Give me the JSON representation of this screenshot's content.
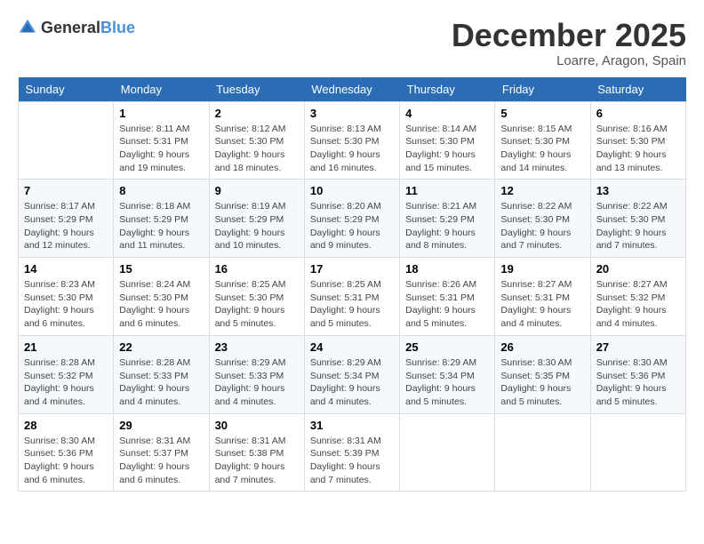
{
  "header": {
    "logo_general": "General",
    "logo_blue": "Blue",
    "month_title": "December 2025",
    "location": "Loarre, Aragon, Spain"
  },
  "days_of_week": [
    "Sunday",
    "Monday",
    "Tuesday",
    "Wednesday",
    "Thursday",
    "Friday",
    "Saturday"
  ],
  "weeks": [
    [
      {
        "day": "",
        "sunrise": "",
        "sunset": "",
        "daylight": ""
      },
      {
        "day": "1",
        "sunrise": "Sunrise: 8:11 AM",
        "sunset": "Sunset: 5:31 PM",
        "daylight": "Daylight: 9 hours and 19 minutes."
      },
      {
        "day": "2",
        "sunrise": "Sunrise: 8:12 AM",
        "sunset": "Sunset: 5:30 PM",
        "daylight": "Daylight: 9 hours and 18 minutes."
      },
      {
        "day": "3",
        "sunrise": "Sunrise: 8:13 AM",
        "sunset": "Sunset: 5:30 PM",
        "daylight": "Daylight: 9 hours and 16 minutes."
      },
      {
        "day": "4",
        "sunrise": "Sunrise: 8:14 AM",
        "sunset": "Sunset: 5:30 PM",
        "daylight": "Daylight: 9 hours and 15 minutes."
      },
      {
        "day": "5",
        "sunrise": "Sunrise: 8:15 AM",
        "sunset": "Sunset: 5:30 PM",
        "daylight": "Daylight: 9 hours and 14 minutes."
      },
      {
        "day": "6",
        "sunrise": "Sunrise: 8:16 AM",
        "sunset": "Sunset: 5:30 PM",
        "daylight": "Daylight: 9 hours and 13 minutes."
      }
    ],
    [
      {
        "day": "7",
        "sunrise": "Sunrise: 8:17 AM",
        "sunset": "Sunset: 5:29 PM",
        "daylight": "Daylight: 9 hours and 12 minutes."
      },
      {
        "day": "8",
        "sunrise": "Sunrise: 8:18 AM",
        "sunset": "Sunset: 5:29 PM",
        "daylight": "Daylight: 9 hours and 11 minutes."
      },
      {
        "day": "9",
        "sunrise": "Sunrise: 8:19 AM",
        "sunset": "Sunset: 5:29 PM",
        "daylight": "Daylight: 9 hours and 10 minutes."
      },
      {
        "day": "10",
        "sunrise": "Sunrise: 8:20 AM",
        "sunset": "Sunset: 5:29 PM",
        "daylight": "Daylight: 9 hours and 9 minutes."
      },
      {
        "day": "11",
        "sunrise": "Sunrise: 8:21 AM",
        "sunset": "Sunset: 5:29 PM",
        "daylight": "Daylight: 9 hours and 8 minutes."
      },
      {
        "day": "12",
        "sunrise": "Sunrise: 8:22 AM",
        "sunset": "Sunset: 5:30 PM",
        "daylight": "Daylight: 9 hours and 7 minutes."
      },
      {
        "day": "13",
        "sunrise": "Sunrise: 8:22 AM",
        "sunset": "Sunset: 5:30 PM",
        "daylight": "Daylight: 9 hours and 7 minutes."
      }
    ],
    [
      {
        "day": "14",
        "sunrise": "Sunrise: 8:23 AM",
        "sunset": "Sunset: 5:30 PM",
        "daylight": "Daylight: 9 hours and 6 minutes."
      },
      {
        "day": "15",
        "sunrise": "Sunrise: 8:24 AM",
        "sunset": "Sunset: 5:30 PM",
        "daylight": "Daylight: 9 hours and 6 minutes."
      },
      {
        "day": "16",
        "sunrise": "Sunrise: 8:25 AM",
        "sunset": "Sunset: 5:30 PM",
        "daylight": "Daylight: 9 hours and 5 minutes."
      },
      {
        "day": "17",
        "sunrise": "Sunrise: 8:25 AM",
        "sunset": "Sunset: 5:31 PM",
        "daylight": "Daylight: 9 hours and 5 minutes."
      },
      {
        "day": "18",
        "sunrise": "Sunrise: 8:26 AM",
        "sunset": "Sunset: 5:31 PM",
        "daylight": "Daylight: 9 hours and 5 minutes."
      },
      {
        "day": "19",
        "sunrise": "Sunrise: 8:27 AM",
        "sunset": "Sunset: 5:31 PM",
        "daylight": "Daylight: 9 hours and 4 minutes."
      },
      {
        "day": "20",
        "sunrise": "Sunrise: 8:27 AM",
        "sunset": "Sunset: 5:32 PM",
        "daylight": "Daylight: 9 hours and 4 minutes."
      }
    ],
    [
      {
        "day": "21",
        "sunrise": "Sunrise: 8:28 AM",
        "sunset": "Sunset: 5:32 PM",
        "daylight": "Daylight: 9 hours and 4 minutes."
      },
      {
        "day": "22",
        "sunrise": "Sunrise: 8:28 AM",
        "sunset": "Sunset: 5:33 PM",
        "daylight": "Daylight: 9 hours and 4 minutes."
      },
      {
        "day": "23",
        "sunrise": "Sunrise: 8:29 AM",
        "sunset": "Sunset: 5:33 PM",
        "daylight": "Daylight: 9 hours and 4 minutes."
      },
      {
        "day": "24",
        "sunrise": "Sunrise: 8:29 AM",
        "sunset": "Sunset: 5:34 PM",
        "daylight": "Daylight: 9 hours and 4 minutes."
      },
      {
        "day": "25",
        "sunrise": "Sunrise: 8:29 AM",
        "sunset": "Sunset: 5:34 PM",
        "daylight": "Daylight: 9 hours and 5 minutes."
      },
      {
        "day": "26",
        "sunrise": "Sunrise: 8:30 AM",
        "sunset": "Sunset: 5:35 PM",
        "daylight": "Daylight: 9 hours and 5 minutes."
      },
      {
        "day": "27",
        "sunrise": "Sunrise: 8:30 AM",
        "sunset": "Sunset: 5:36 PM",
        "daylight": "Daylight: 9 hours and 5 minutes."
      }
    ],
    [
      {
        "day": "28",
        "sunrise": "Sunrise: 8:30 AM",
        "sunset": "Sunset: 5:36 PM",
        "daylight": "Daylight: 9 hours and 6 minutes."
      },
      {
        "day": "29",
        "sunrise": "Sunrise: 8:31 AM",
        "sunset": "Sunset: 5:37 PM",
        "daylight": "Daylight: 9 hours and 6 minutes."
      },
      {
        "day": "30",
        "sunrise": "Sunrise: 8:31 AM",
        "sunset": "Sunset: 5:38 PM",
        "daylight": "Daylight: 9 hours and 7 minutes."
      },
      {
        "day": "31",
        "sunrise": "Sunrise: 8:31 AM",
        "sunset": "Sunset: 5:39 PM",
        "daylight": "Daylight: 9 hours and 7 minutes."
      },
      {
        "day": "",
        "sunrise": "",
        "sunset": "",
        "daylight": ""
      },
      {
        "day": "",
        "sunrise": "",
        "sunset": "",
        "daylight": ""
      },
      {
        "day": "",
        "sunrise": "",
        "sunset": "",
        "daylight": ""
      }
    ]
  ]
}
